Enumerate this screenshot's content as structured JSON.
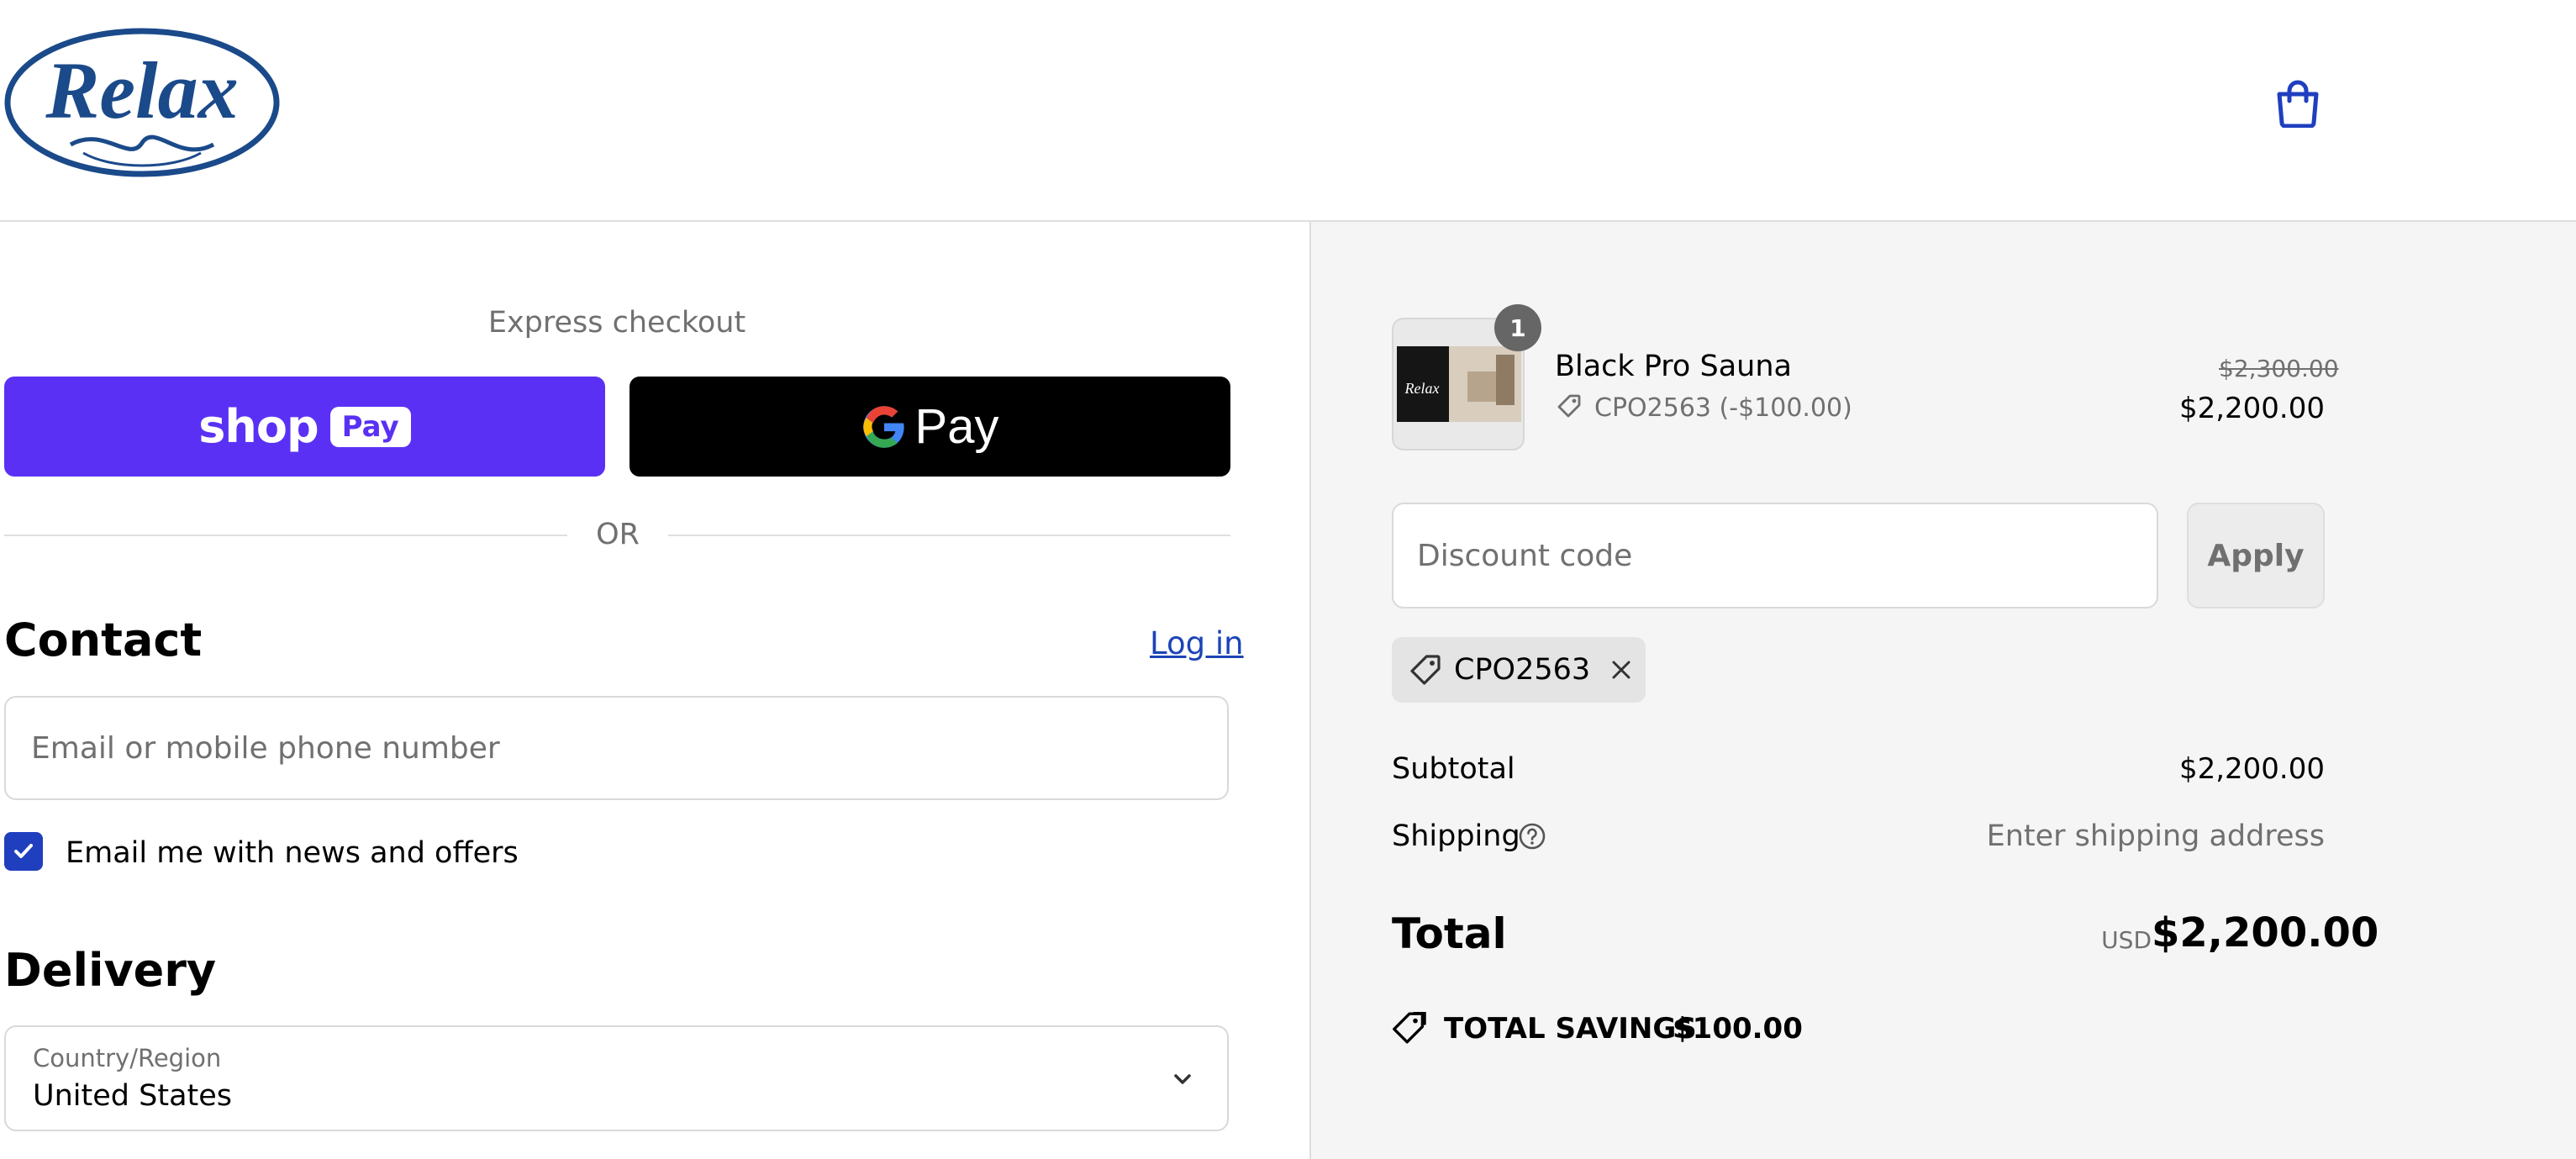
{
  "header": {
    "logo_text": "Relax",
    "cart_icon": "shopping-bag-icon",
    "brand_color": "#1b4a8a"
  },
  "express": {
    "label": "Express checkout",
    "shop_pay": {
      "word": "shop",
      "pill": "Pay",
      "color": "#5a31f4"
    },
    "google_pay": {
      "pay": "Pay",
      "color": "#000000"
    },
    "divider": "OR"
  },
  "contact": {
    "heading": "Contact",
    "login_link": "Log in",
    "email_placeholder": "Email or mobile phone number",
    "email_value": "",
    "newsletter_label": "Email me with news and offers",
    "newsletter_checked": true
  },
  "delivery": {
    "heading": "Delivery",
    "country_label": "Country/Region",
    "country_value": "United States"
  },
  "summary": {
    "item": {
      "quantity": "1",
      "name": "Black Pro Sauna",
      "discount_line": "CPO2563 (-$100.00)",
      "original_price": "$2,300.00",
      "price": "$2,200.00",
      "thumb_text": "Relax"
    },
    "discount": {
      "placeholder": "Discount code",
      "value": "",
      "apply_label": "Apply",
      "applied_code": "CPO2563"
    },
    "subtotal_label": "Subtotal",
    "subtotal_value": "$2,200.00",
    "shipping_label": "Shipping",
    "shipping_value": "Enter shipping address",
    "total_label": "Total",
    "total_currency": "USD",
    "total_value": "$2,200.00",
    "savings_label": "TOTAL SAVINGS",
    "savings_value": "$100.00"
  }
}
